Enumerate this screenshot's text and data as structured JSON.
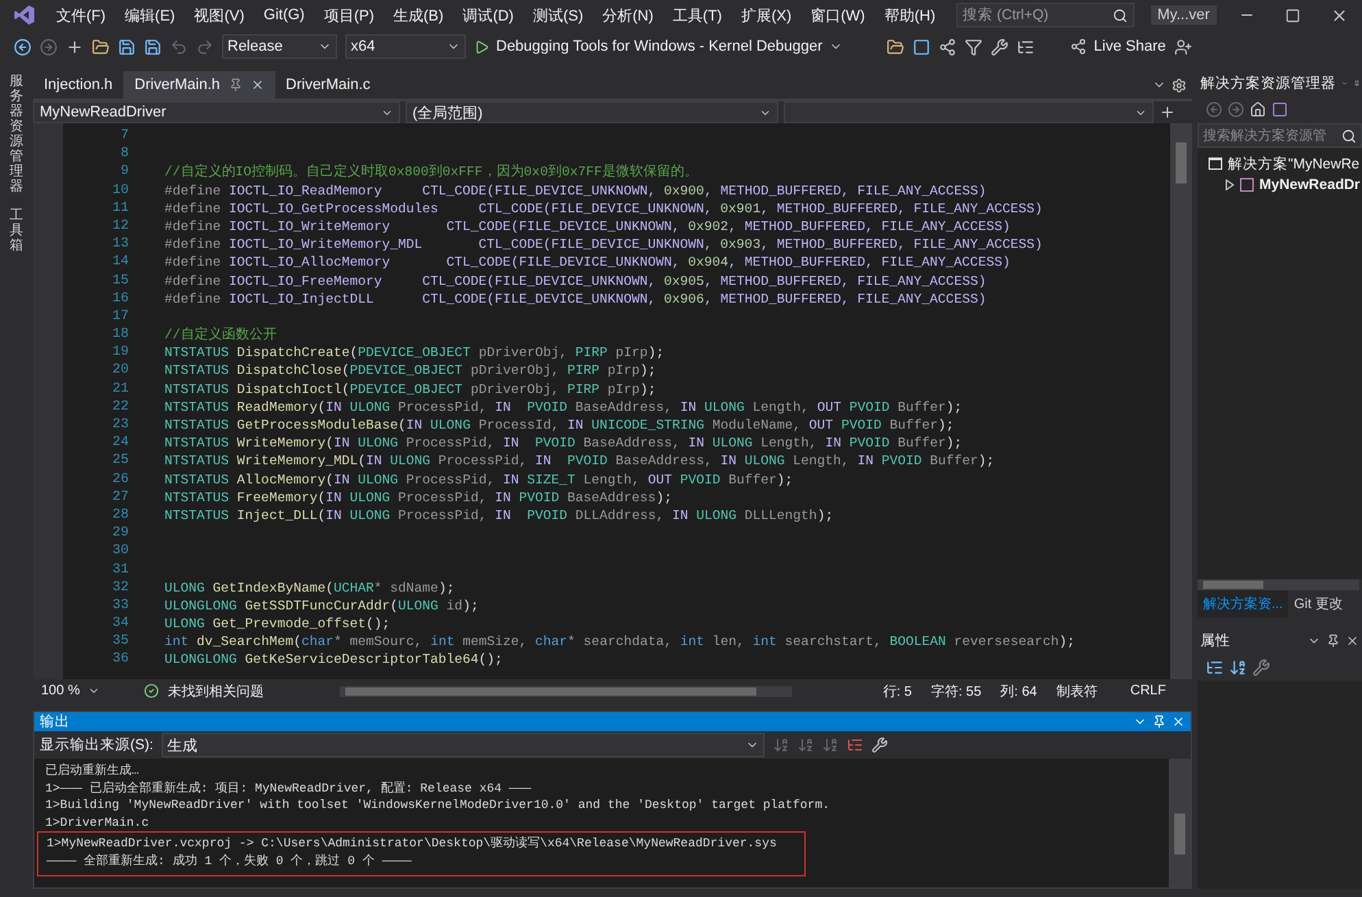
{
  "title_bar": {
    "menu": [
      "文件(F)",
      "编辑(E)",
      "视图(V)",
      "Git(G)",
      "项目(P)",
      "生成(B)",
      "调试(D)",
      "测试(S)",
      "分析(N)",
      "工具(T)",
      "扩展(X)",
      "窗口(W)",
      "帮助(H)"
    ],
    "search": {
      "placeholder": "搜索 (Ctrl+Q)"
    },
    "solution_name": "My...ver"
  },
  "toolbar": {
    "configuration": "Release",
    "platform": "x64",
    "debugger": "Debugging Tools for Windows - Kernel Debugger",
    "live_share": "Live Share"
  },
  "left_strip": [
    "服务器资源管理器",
    "工具箱"
  ],
  "doc_tabs": [
    {
      "label": "Injection.h",
      "selected": false
    },
    {
      "label": "DriverMain.h",
      "selected": true
    },
    {
      "label": "DriverMain.c",
      "selected": false
    }
  ],
  "nav_bar": {
    "project": "MyNewReadDriver",
    "scope": "(全局范围)"
  },
  "code_lines": [
    {
      "number": "7"
    },
    {
      "number": "8"
    },
    {
      "number": "9",
      "tokens": [
        {
          "kind": "comment",
          "text": "//自定义的IO控制码。自己定义时取0x800到0xFFF，因为0x0到0x7FF是微软保留的。"
        }
      ]
    },
    {
      "number": "10",
      "tokens": [
        {
          "kind": "pre",
          "text": "#define "
        },
        {
          "kind": "macro",
          "text": "IOCTL_IO_ReadMemory     CTL_CODE(FILE_DEVICE_UNKNOWN, "
        },
        {
          "kind": "num",
          "text": "0x900"
        },
        {
          "kind": "macro",
          "text": ", METHOD_BUFFERED, FILE_ANY_ACCESS)"
        }
      ]
    },
    {
      "number": "11",
      "tokens": [
        {
          "kind": "pre",
          "text": "#define "
        },
        {
          "kind": "macro",
          "text": "IOCTL_IO_GetProcessModules     CTL_CODE(FILE_DEVICE_UNKNOWN, "
        },
        {
          "kind": "num",
          "text": "0x901"
        },
        {
          "kind": "macro",
          "text": ", METHOD_BUFFERED, FILE_ANY_ACCESS)"
        }
      ]
    },
    {
      "number": "12",
      "tokens": [
        {
          "kind": "pre",
          "text": "#define "
        },
        {
          "kind": "macro",
          "text": "IOCTL_IO_WriteMemory       CTL_CODE(FILE_DEVICE_UNKNOWN, "
        },
        {
          "kind": "num",
          "text": "0x902"
        },
        {
          "kind": "macro",
          "text": ", METHOD_BUFFERED, FILE_ANY_ACCESS)"
        }
      ]
    },
    {
      "number": "13",
      "tokens": [
        {
          "kind": "pre",
          "text": "#define "
        },
        {
          "kind": "macro",
          "text": "IOCTL_IO_WriteMemory_MDL       CTL_CODE(FILE_DEVICE_UNKNOWN, "
        },
        {
          "kind": "num",
          "text": "0x903"
        },
        {
          "kind": "macro",
          "text": ", METHOD_BUFFERED, FILE_ANY_ACCESS)"
        }
      ]
    },
    {
      "number": "14",
      "tokens": [
        {
          "kind": "pre",
          "text": "#define "
        },
        {
          "kind": "macro",
          "text": "IOCTL_IO_AllocMemory       CTL_CODE(FILE_DEVICE_UNKNOWN, "
        },
        {
          "kind": "num",
          "text": "0x904"
        },
        {
          "kind": "macro",
          "text": ", METHOD_BUFFERED, FILE_ANY_ACCESS)"
        }
      ]
    },
    {
      "number": "15",
      "tokens": [
        {
          "kind": "pre",
          "text": "#define "
        },
        {
          "kind": "macro",
          "text": "IOCTL_IO_FreeMemory     CTL_CODE(FILE_DEVICE_UNKNOWN, "
        },
        {
          "kind": "num",
          "text": "0x905"
        },
        {
          "kind": "macro",
          "text": ", METHOD_BUFFERED, FILE_ANY_ACCESS)"
        }
      ]
    },
    {
      "number": "16",
      "tokens": [
        {
          "kind": "pre",
          "text": "#define "
        },
        {
          "kind": "macro",
          "text": "IOCTL_IO_InjectDLL      CTL_CODE(FILE_DEVICE_UNKNOWN, "
        },
        {
          "kind": "num",
          "text": "0x906"
        },
        {
          "kind": "macro",
          "text": ", METHOD_BUFFERED, FILE_ANY_ACCESS)"
        }
      ]
    },
    {
      "number": "17"
    },
    {
      "number": "18",
      "tokens": [
        {
          "kind": "comment",
          "text": "//自定义函数公开"
        }
      ]
    },
    {
      "number": "19",
      "tokens": [
        {
          "kind": "type",
          "text": "NTSTATUS "
        },
        {
          "kind": "func",
          "text": "DispatchCreate"
        },
        {
          "kind": "plain",
          "text": "("
        },
        {
          "kind": "type",
          "text": "PDEVICE_OBJECT"
        },
        {
          "kind": "param",
          "text": " pDriverObj, "
        },
        {
          "kind": "type",
          "text": "PIRP"
        },
        {
          "kind": "param",
          "text": " pIrp"
        },
        {
          "kind": "plain",
          "text": ");"
        }
      ]
    },
    {
      "number": "20",
      "tokens": [
        {
          "kind": "type",
          "text": "NTSTATUS "
        },
        {
          "kind": "func",
          "text": "DispatchClose"
        },
        {
          "kind": "plain",
          "text": "("
        },
        {
          "kind": "type",
          "text": "PDEVICE_OBJECT"
        },
        {
          "kind": "param",
          "text": " pDriverObj, "
        },
        {
          "kind": "type",
          "text": "PIRP"
        },
        {
          "kind": "param",
          "text": " pIrp"
        },
        {
          "kind": "plain",
          "text": ");"
        }
      ]
    },
    {
      "number": "21",
      "tokens": [
        {
          "kind": "type",
          "text": "NTSTATUS "
        },
        {
          "kind": "func",
          "text": "DispatchIoctl"
        },
        {
          "kind": "plain",
          "text": "("
        },
        {
          "kind": "type",
          "text": "PDEVICE_OBJECT"
        },
        {
          "kind": "param",
          "text": " pDriverObj, "
        },
        {
          "kind": "type",
          "text": "PIRP"
        },
        {
          "kind": "param",
          "text": " pIrp"
        },
        {
          "kind": "plain",
          "text": ");"
        }
      ]
    },
    {
      "number": "22",
      "tokens": [
        {
          "kind": "type",
          "text": "NTSTATUS "
        },
        {
          "kind": "func",
          "text": "ReadMemory"
        },
        {
          "kind": "plain",
          "text": "("
        },
        {
          "kind": "macro",
          "text": "IN "
        },
        {
          "kind": "type",
          "text": "ULONG"
        },
        {
          "kind": "param",
          "text": " ProcessPid, "
        },
        {
          "kind": "macro",
          "text": "IN  "
        },
        {
          "kind": "type",
          "text": "PVOID"
        },
        {
          "kind": "param",
          "text": " BaseAddress, "
        },
        {
          "kind": "macro",
          "text": "IN "
        },
        {
          "kind": "type",
          "text": "ULONG"
        },
        {
          "kind": "param",
          "text": " Length, "
        },
        {
          "kind": "macro",
          "text": "OUT "
        },
        {
          "kind": "type",
          "text": "PVOID"
        },
        {
          "kind": "param",
          "text": " Buffer"
        },
        {
          "kind": "plain",
          "text": ");"
        }
      ]
    },
    {
      "number": "23",
      "tokens": [
        {
          "kind": "type",
          "text": "NTSTATUS "
        },
        {
          "kind": "func",
          "text": "GetProcessModuleBase"
        },
        {
          "kind": "plain",
          "text": "("
        },
        {
          "kind": "macro",
          "text": "IN "
        },
        {
          "kind": "type",
          "text": "ULONG"
        },
        {
          "kind": "param",
          "text": " ProcessId, "
        },
        {
          "kind": "macro",
          "text": "IN "
        },
        {
          "kind": "type",
          "text": "UNICODE_STRING"
        },
        {
          "kind": "param",
          "text": " ModuleName, "
        },
        {
          "kind": "macro",
          "text": "OUT "
        },
        {
          "kind": "type",
          "text": "PVOID"
        },
        {
          "kind": "param",
          "text": " Buffer"
        },
        {
          "kind": "plain",
          "text": ");"
        }
      ]
    },
    {
      "number": "24",
      "tokens": [
        {
          "kind": "type",
          "text": "NTSTATUS "
        },
        {
          "kind": "func",
          "text": "WriteMemory"
        },
        {
          "kind": "plain",
          "text": "("
        },
        {
          "kind": "macro",
          "text": "IN "
        },
        {
          "kind": "type",
          "text": "ULONG"
        },
        {
          "kind": "param",
          "text": " ProcessPid, "
        },
        {
          "kind": "macro",
          "text": "IN  "
        },
        {
          "kind": "type",
          "text": "PVOID"
        },
        {
          "kind": "param",
          "text": " BaseAddress, "
        },
        {
          "kind": "macro",
          "text": "IN "
        },
        {
          "kind": "type",
          "text": "ULONG"
        },
        {
          "kind": "param",
          "text": " Length, "
        },
        {
          "kind": "macro",
          "text": "IN "
        },
        {
          "kind": "type",
          "text": "PVOID"
        },
        {
          "kind": "param",
          "text": " Buffer"
        },
        {
          "kind": "plain",
          "text": ");"
        }
      ]
    },
    {
      "number": "25",
      "tokens": [
        {
          "kind": "type",
          "text": "NTSTATUS "
        },
        {
          "kind": "func",
          "text": "WriteMemory_MDL"
        },
        {
          "kind": "plain",
          "text": "("
        },
        {
          "kind": "macro",
          "text": "IN "
        },
        {
          "kind": "type",
          "text": "ULONG"
        },
        {
          "kind": "param",
          "text": " ProcessPid, "
        },
        {
          "kind": "macro",
          "text": "IN  "
        },
        {
          "kind": "type",
          "text": "PVOID"
        },
        {
          "kind": "param",
          "text": " BaseAddress, "
        },
        {
          "kind": "macro",
          "text": "IN "
        },
        {
          "kind": "type",
          "text": "ULONG"
        },
        {
          "kind": "param",
          "text": " Length, "
        },
        {
          "kind": "macro",
          "text": "IN "
        },
        {
          "kind": "type",
          "text": "PVOID"
        },
        {
          "kind": "param",
          "text": " Buffer"
        },
        {
          "kind": "plain",
          "text": ");"
        }
      ]
    },
    {
      "number": "26",
      "tokens": [
        {
          "kind": "type",
          "text": "NTSTATUS "
        },
        {
          "kind": "func",
          "text": "AllocMemory"
        },
        {
          "kind": "plain",
          "text": "("
        },
        {
          "kind": "macro",
          "text": "IN "
        },
        {
          "kind": "type",
          "text": "ULONG"
        },
        {
          "kind": "param",
          "text": " ProcessPid, "
        },
        {
          "kind": "macro",
          "text": "IN "
        },
        {
          "kind": "type",
          "text": "SIZE_T"
        },
        {
          "kind": "param",
          "text": " Length, "
        },
        {
          "kind": "macro",
          "text": "OUT "
        },
        {
          "kind": "type",
          "text": "PVOID"
        },
        {
          "kind": "param",
          "text": " Buffer"
        },
        {
          "kind": "plain",
          "text": ");"
        }
      ]
    },
    {
      "number": "27",
      "tokens": [
        {
          "kind": "type",
          "text": "NTSTATUS "
        },
        {
          "kind": "func",
          "text": "FreeMemory"
        },
        {
          "kind": "plain",
          "text": "("
        },
        {
          "kind": "macro",
          "text": "IN "
        },
        {
          "kind": "type",
          "text": "ULONG"
        },
        {
          "kind": "param",
          "text": " ProcessPid, "
        },
        {
          "kind": "macro",
          "text": "IN "
        },
        {
          "kind": "type",
          "text": "PVOID"
        },
        {
          "kind": "param",
          "text": " BaseAddress"
        },
        {
          "kind": "plain",
          "text": ");"
        }
      ]
    },
    {
      "number": "28",
      "tokens": [
        {
          "kind": "type",
          "text": "NTSTATUS "
        },
        {
          "kind": "func",
          "text": "Inject_DLL"
        },
        {
          "kind": "plain",
          "text": "("
        },
        {
          "kind": "macro",
          "text": "IN "
        },
        {
          "kind": "type",
          "text": "ULONG"
        },
        {
          "kind": "param",
          "text": " ProcessPid, "
        },
        {
          "kind": "macro",
          "text": "IN  "
        },
        {
          "kind": "type",
          "text": "PVOID"
        },
        {
          "kind": "param",
          "text": " DLLAddress, "
        },
        {
          "kind": "macro",
          "text": "IN "
        },
        {
          "kind": "type",
          "text": "ULONG"
        },
        {
          "kind": "param",
          "text": " DLLLength"
        },
        {
          "kind": "plain",
          "text": ");"
        }
      ]
    },
    {
      "number": "29"
    },
    {
      "number": "30"
    },
    {
      "number": "31"
    },
    {
      "number": "32",
      "tokens": [
        {
          "kind": "type",
          "text": "ULONG "
        },
        {
          "kind": "func",
          "text": "GetIndexByName"
        },
        {
          "kind": "plain",
          "text": "("
        },
        {
          "kind": "type",
          "text": "UCHAR"
        },
        {
          "kind": "param",
          "text": "* sdName"
        },
        {
          "kind": "plain",
          "text": ");"
        }
      ]
    },
    {
      "number": "33",
      "tokens": [
        {
          "kind": "type",
          "text": "ULONGLONG "
        },
        {
          "kind": "func",
          "text": "GetSSDTFuncCurAddr"
        },
        {
          "kind": "plain",
          "text": "("
        },
        {
          "kind": "type",
          "text": "ULONG"
        },
        {
          "kind": "param",
          "text": " id"
        },
        {
          "kind": "plain",
          "text": ");"
        }
      ]
    },
    {
      "number": "34",
      "tokens": [
        {
          "kind": "type",
          "text": "ULONG "
        },
        {
          "kind": "func",
          "text": "Get_Prevmode_offset"
        },
        {
          "kind": "plain",
          "text": "();"
        }
      ]
    },
    {
      "number": "35",
      "tokens": [
        {
          "kind": "kw",
          "text": "int "
        },
        {
          "kind": "func",
          "text": "dv_SearchMem"
        },
        {
          "kind": "plain",
          "text": "("
        },
        {
          "kind": "kw",
          "text": "char"
        },
        {
          "kind": "param",
          "text": "* memSourc, "
        },
        {
          "kind": "kw",
          "text": "int"
        },
        {
          "kind": "param",
          "text": " memSize, "
        },
        {
          "kind": "kw",
          "text": "char"
        },
        {
          "kind": "param",
          "text": "* searchdata, "
        },
        {
          "kind": "kw",
          "text": "int"
        },
        {
          "kind": "param",
          "text": " len, "
        },
        {
          "kind": "kw",
          "text": "int"
        },
        {
          "kind": "param",
          "text": " searchstart, "
        },
        {
          "kind": "type",
          "text": "BOOLEAN"
        },
        {
          "kind": "param",
          "text": " reversesearch"
        },
        {
          "kind": "plain",
          "text": ");"
        }
      ]
    },
    {
      "number": "36",
      "tokens": [
        {
          "kind": "type",
          "text": "ULONGLONG "
        },
        {
          "kind": "func",
          "text": "GetKeServiceDescriptorTable64"
        },
        {
          "kind": "plain",
          "text": "();"
        }
      ]
    }
  ],
  "status_bar": {
    "zoom": "100 %",
    "issues": "未找到相关问题",
    "line": "行: 5",
    "char": "字符: 55",
    "column": "列: 64",
    "indent": "制表符",
    "line_ending": "CRLF"
  },
  "output": {
    "title": "输出",
    "source_label": "显示输出来源(S):",
    "source": "生成",
    "lines": [
      {
        "text": "已启动重新生成…",
        "highlighted": false
      },
      {
        "text": "1>——— 已启动全部重新生成: 项目: MyNewReadDriver, 配置: Release x64 ———",
        "highlighted": false
      },
      {
        "text": "1>Building 'MyNewReadDriver' with toolset 'WindowsKernelModeDriver10.0' and the 'Desktop' target platform.",
        "highlighted": false
      },
      {
        "text": "1>DriverMain.c",
        "highlighted": false
      },
      {
        "text": "1>MyNewReadDriver.vcxproj -> C:\\Users\\Administrator\\Desktop\\驱动读写\\x64\\Release\\MyNewReadDriver.sys",
        "highlighted": true
      },
      {
        "text": "———— 全部重新生成: 成功 1 个，失败 0 个，跳过 0 个 ————",
        "highlighted": true
      }
    ]
  },
  "solution_explorer": {
    "title": "解决方案资源管理器",
    "search": {
      "placeholder": "搜索解决方案资源管"
    },
    "tree": [
      {
        "label": "解决方案\"MyNewRe",
        "expanded": true,
        "children": [
          {
            "label": "MyNewReadDr",
            "expanded": false
          }
        ]
      }
    ],
    "tabs": [
      {
        "label": "解决方案资...",
        "selected": true
      },
      {
        "label": "Git 更改",
        "selected": false
      }
    ]
  },
  "properties": {
    "title": "属性"
  }
}
